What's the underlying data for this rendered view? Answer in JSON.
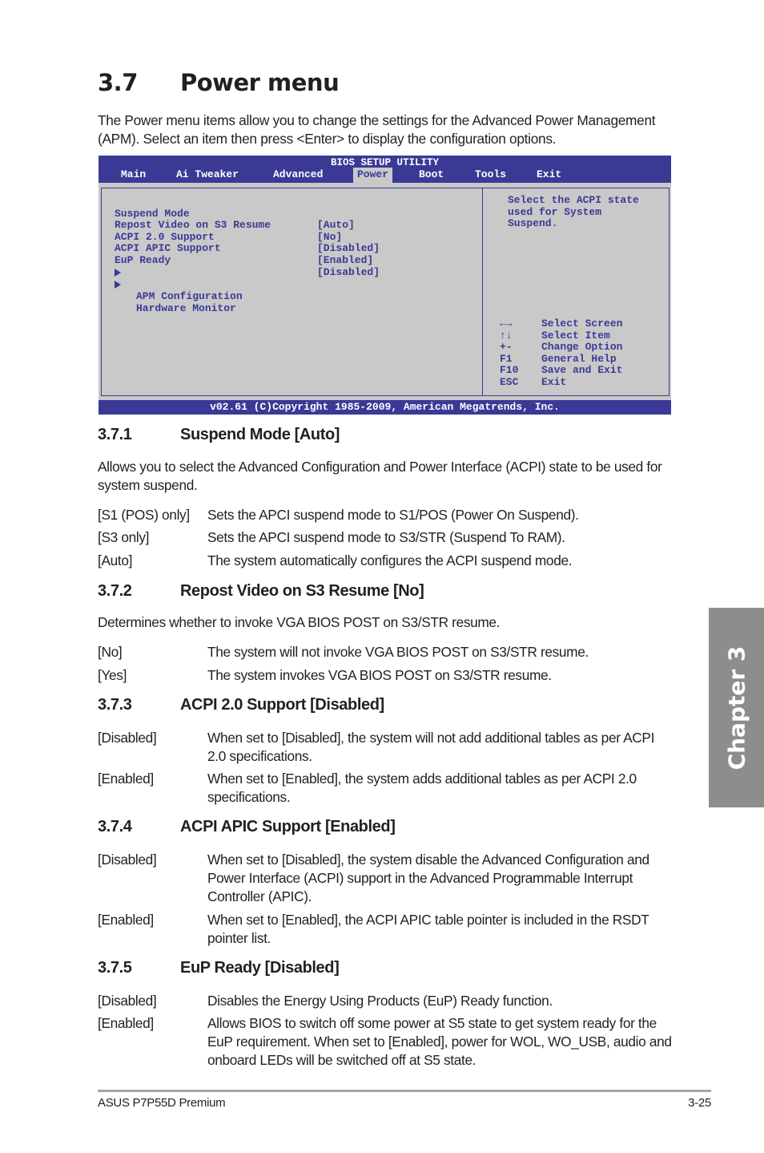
{
  "page": {
    "section_number": "3.7",
    "section_title": "Power menu",
    "intro": "The Power menu items allow you to change the settings for the Advanced Power Management (APM). Select an item then press <Enter> to display the configuration options."
  },
  "bios": {
    "title": "BIOS SETUP UTILITY",
    "tabs": [
      {
        "label": "Main",
        "active": false
      },
      {
        "label": "Ai Tweaker",
        "active": false
      },
      {
        "label": "Advanced",
        "active": false
      },
      {
        "label": "Power",
        "active": true
      },
      {
        "label": "Boot",
        "active": false
      },
      {
        "label": "Tools",
        "active": false
      },
      {
        "label": "Exit",
        "active": false
      }
    ],
    "settings": [
      {
        "label": "Suspend Mode",
        "value": "[Auto]"
      },
      {
        "label": "Repost Video on S3 Resume",
        "value": "[No]"
      },
      {
        "label": "ACPI 2.0 Support",
        "value": "[Disabled]"
      },
      {
        "label": "ACPI APIC Support",
        "value": "[Enabled]"
      },
      {
        "label": "EuP Ready",
        "value": "[Disabled]"
      }
    ],
    "submenus": [
      {
        "label": "APM Configuration",
        "icon": "triangle-right-icon"
      },
      {
        "label": "Hardware Monitor",
        "icon": "triangle-right-icon"
      }
    ],
    "help_text": "Select the ACPI state\nused for System\nSuspend.",
    "keys": [
      {
        "key": "←→",
        "desc": "Select Screen"
      },
      {
        "key": "↑↓",
        "desc": "Select Item"
      },
      {
        "key": "+-",
        "desc": "Change Option"
      },
      {
        "key": "F1",
        "desc": "General Help"
      },
      {
        "key": "F10",
        "desc": "Save and Exit"
      },
      {
        "key": "ESC",
        "desc": "Exit"
      }
    ],
    "footer": "v02.61 (C)Copyright 1985-2009, American Megatrends, Inc.",
    "colors": {
      "header_bg": "#3a3a96",
      "body_bg": "#c9c9c9",
      "text": "#3a3a96"
    }
  },
  "sections": [
    {
      "number": "3.7.1",
      "title": "Suspend Mode [Auto]",
      "description": "Allows you to select the Advanced Configuration and Power Interface (ACPI) state to be used for system suspend.",
      "options": [
        {
          "key": "[S1 (POS) only]",
          "desc": "Sets the APCI suspend mode to S1/POS (Power On Suspend)."
        },
        {
          "key": "[S3 only]",
          "desc": "Sets the APCI suspend mode to S3/STR (Suspend To RAM)."
        },
        {
          "key": "[Auto]",
          "desc": "The system automatically configures the ACPI suspend mode."
        }
      ]
    },
    {
      "number": "3.7.2",
      "title": "Repost Video on S3 Resume [No]",
      "description": "Determines whether to invoke VGA BIOS POST on S3/STR resume.",
      "options": [
        {
          "key": "[No]",
          "desc": "The system will not invoke VGA BIOS POST on S3/STR resume."
        },
        {
          "key": "[Yes]",
          "desc": "The system invokes VGA BIOS POST on S3/STR resume."
        }
      ]
    },
    {
      "number": "3.7.3",
      "title": "ACPI 2.0 Support [Disabled]",
      "options": [
        {
          "key": "[Disabled]",
          "desc": "When set to [Disabled], the system will not add additional tables as per ACPI 2.0 specifications."
        },
        {
          "key": "[Enabled]",
          "desc": "When set to [Enabled], the system adds additional tables as per ACPI 2.0 specifications."
        }
      ]
    },
    {
      "number": "3.7.4",
      "title": "ACPI APIC Support [Enabled]",
      "options": [
        {
          "key": "[Disabled]",
          "desc": "When set to [Disabled], the system disable the Advanced Configuration and Power Interface (ACPI) support in the Advanced Programmable Interrupt Controller (APIC)."
        },
        {
          "key": "[Enabled]",
          "desc": "When set to [Enabled], the ACPI APIC table pointer is included in the RSDT pointer list."
        }
      ]
    },
    {
      "number": "3.7.5",
      "title": "EuP Ready [Disabled]",
      "options": [
        {
          "key": "[Disabled]",
          "desc": "Disables the Energy Using Products (EuP) Ready function."
        },
        {
          "key": "[Enabled]",
          "desc": "Allows BIOS to switch off some power at S5 state to get system ready for the EuP requirement. When set to [Enabled], power for WOL, WO_USB, audio and onboard LEDs will be switched off at S5 state."
        }
      ]
    }
  ],
  "chapter_tab": "Chapter 3",
  "footer": {
    "product": "ASUS P7P55D Premium",
    "page_number": "3-25"
  }
}
